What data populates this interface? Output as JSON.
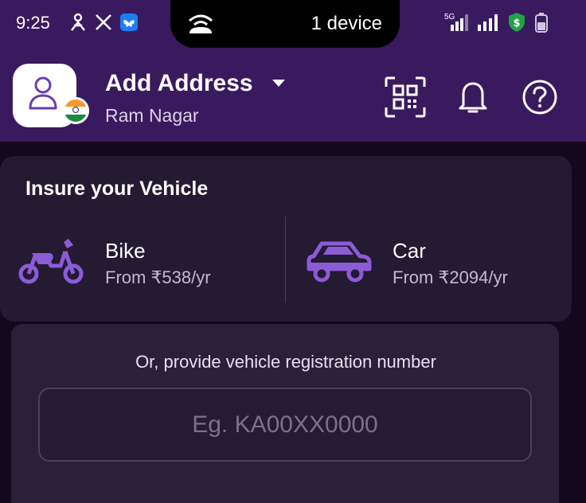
{
  "status_bar": {
    "time": "9:25",
    "dynamic_island_text": "1 device",
    "network_label": "5G"
  },
  "header": {
    "title": "Add Address",
    "subtitle": "Ram Nagar"
  },
  "insure_card": {
    "title": "Insure your Vehicle",
    "options": [
      {
        "name": "Bike",
        "price": "From ₹538/yr"
      },
      {
        "name": "Car",
        "price": "From ₹2094/yr"
      }
    ]
  },
  "registration": {
    "label": "Or, provide vehicle registration number",
    "placeholder": "Eg. KA00XX0000"
  },
  "colors": {
    "header_bg": "#3a1a5e",
    "page_bg": "#12091c",
    "card_bg": "#241a32",
    "accent_purple": "#8b5cd6"
  }
}
